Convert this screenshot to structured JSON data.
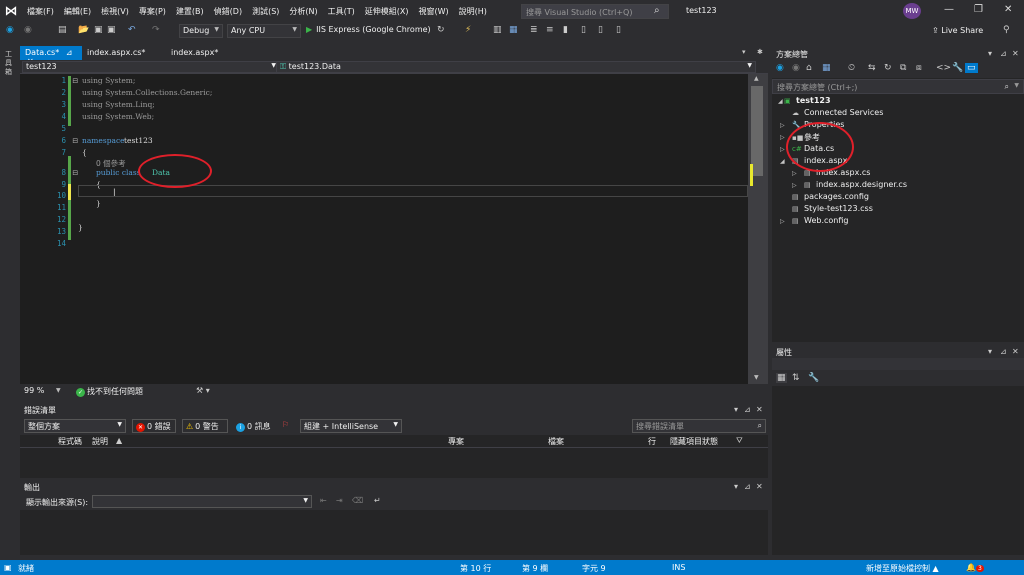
{
  "titlebar": {
    "menus": [
      "檔案(F)",
      "編輯(E)",
      "檢視(V)",
      "專案(P)",
      "建置(B)",
      "偵錯(D)",
      "測試(S)",
      "分析(N)",
      "工具(T)",
      "延伸模組(X)",
      "視窗(W)",
      "說明(H)"
    ],
    "search_placeholder": "搜尋 Visual Studio (Ctrl+Q)",
    "solution_title": "test123",
    "avatar_initials": "MW"
  },
  "toolbar": {
    "config": "Debug",
    "platform": "Any CPU",
    "run_label": "IIS Express (Google Chrome)",
    "live_share": "Live Share"
  },
  "left_strip": {
    "toolbox_label": "工具箱"
  },
  "doc_tabs": [
    {
      "label": "Data.cs*",
      "active": true
    },
    {
      "label": "index.aspx.cs*",
      "active": false
    },
    {
      "label": "index.aspx*",
      "active": false
    }
  ],
  "navbar": {
    "project": "test123",
    "type": "test123.Data"
  },
  "editor": {
    "line_numbers": [
      "1",
      "2",
      "3",
      "4",
      "5",
      "6",
      "7",
      "8",
      "9",
      "10",
      "11",
      "12",
      "13",
      "14"
    ],
    "code": {
      "l1": "using System;",
      "l2": "using System.Collections.Generic;",
      "l3": "using System.Linq;",
      "l4": "using System.Web;",
      "l6_kw": "namespace",
      "l6_name": "test123",
      "l7": "{",
      "codelens": "0 個參考",
      "l8_kw": "public class",
      "l8_name": "Data",
      "l9": "{",
      "l11": "}",
      "l13": "}"
    },
    "zoom": "99 %",
    "issues": "找不到任何問題"
  },
  "error_list": {
    "title": "錯誤清單",
    "scope": "整個方案",
    "errors": "0 錯誤",
    "warnings": "0 警告",
    "messages": "0 訊息",
    "build_filter": "組建 + IntelliSense",
    "search_placeholder": "搜尋錯誤清單",
    "columns": [
      "程式碼",
      "說明",
      "專案",
      "檔案",
      "行",
      "隱藏項目狀態"
    ]
  },
  "output": {
    "title": "輸出",
    "source_label": "顯示輸出來源(S):"
  },
  "solution_explorer": {
    "title": "方案總管",
    "search_placeholder": "搜尋方案總管 (Ctrl+;)",
    "items": [
      {
        "label": "test123",
        "icon": "web-project-icon"
      },
      {
        "label": "Connected Services",
        "icon": "cloud-icon"
      },
      {
        "label": "Properties",
        "icon": "wrench-icon"
      },
      {
        "label": "參考",
        "icon": "references-icon"
      },
      {
        "label": "Data.cs",
        "icon": "csharp-file-icon"
      },
      {
        "label": "index.aspx",
        "icon": "aspx-file-icon"
      },
      {
        "label": "index.aspx.cs",
        "icon": "csharp-file-icon"
      },
      {
        "label": "index.aspx.designer.cs",
        "icon": "csharp-file-icon"
      },
      {
        "label": "packages.config",
        "icon": "config-file-icon"
      },
      {
        "label": "Style-test123.css",
        "icon": "css-file-icon"
      },
      {
        "label": "Web.config",
        "icon": "config-file-icon"
      }
    ]
  },
  "properties": {
    "title": "屬性"
  },
  "statusbar": {
    "ready": "就緒",
    "line": "第 10 行",
    "col": "第 9 欄",
    "char": "字元 9",
    "mode": "INS",
    "source_control": "新增至原始檔控制",
    "notifications": "3"
  },
  "colors": {
    "accent": "#007acc",
    "annotation": "#e0202a",
    "keyword": "#569cd6",
    "type": "#4ec9b0"
  }
}
